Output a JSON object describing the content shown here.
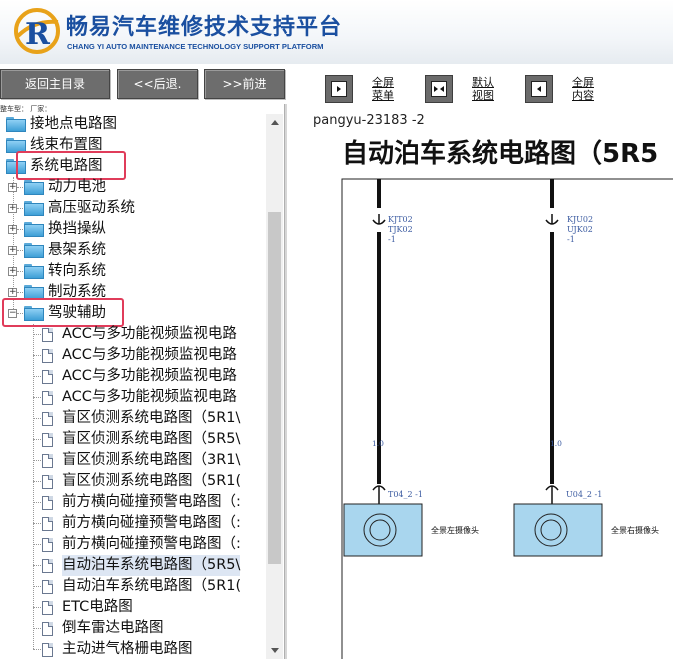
{
  "header": {
    "title": "畅易汽车维修技术支持平台",
    "subtitle": "CHANG YI AUTO MAINTENANCE TECHNOLOGY SUPPORT PLATFORM",
    "brand_color": "#1a4fa0"
  },
  "toolbar": {
    "home_label": "返回主目录",
    "back_label": "<<后退.",
    "forward_label": ">>前进",
    "tools": [
      {
        "icon": "fullscreen-menu-icon",
        "label": "全屏\n菜单"
      },
      {
        "icon": "default-view-icon",
        "label": "默认\n视图"
      },
      {
        "icon": "fullscreen-content-icon",
        "label": "全屏\n内容"
      }
    ]
  },
  "sidebar": {
    "meta": "整车型：  厂家：",
    "tree": [
      {
        "label": "接地点电路图",
        "type": "folder",
        "level": 0
      },
      {
        "label": "线束布置图",
        "type": "folder",
        "level": 0
      },
      {
        "label": "系统电路图",
        "type": "folder-open",
        "level": 0,
        "highlighted": true
      },
      {
        "label": "动力电池",
        "type": "folder",
        "level": 1
      },
      {
        "label": "高压驱动系统",
        "type": "folder",
        "level": 1
      },
      {
        "label": "换挡操纵",
        "type": "folder",
        "level": 1
      },
      {
        "label": "悬架系统",
        "type": "folder",
        "level": 1
      },
      {
        "label": "转向系统",
        "type": "folder",
        "level": 1
      },
      {
        "label": "制动系统",
        "type": "folder",
        "level": 1
      },
      {
        "label": "驾驶辅助",
        "type": "folder-open",
        "level": 1,
        "highlighted": true
      },
      {
        "label": "ACC与多功能视频监视电路",
        "type": "doc",
        "level": 2
      },
      {
        "label": "ACC与多功能视频监视电路",
        "type": "doc",
        "level": 2
      },
      {
        "label": "ACC与多功能视频监视电路",
        "type": "doc",
        "level": 2
      },
      {
        "label": "ACC与多功能视频监视电路",
        "type": "doc",
        "level": 2
      },
      {
        "label": "盲区侦测系统电路图（5R1\\",
        "type": "doc",
        "level": 2
      },
      {
        "label": "盲区侦测系统电路图（5R5\\",
        "type": "doc",
        "level": 2
      },
      {
        "label": "盲区侦测系统电路图（3R1\\",
        "type": "doc",
        "level": 2
      },
      {
        "label": "盲区侦测系统电路图（5R1(",
        "type": "doc",
        "level": 2
      },
      {
        "label": "前方横向碰撞预警电路图（:",
        "type": "doc",
        "level": 2
      },
      {
        "label": "前方横向碰撞预警电路图（:",
        "type": "doc",
        "level": 2
      },
      {
        "label": "前方横向碰撞预警电路图（:",
        "type": "doc",
        "level": 2
      },
      {
        "label": "自动泊车系统电路图（5R5\\",
        "type": "doc",
        "level": 2,
        "selected": true
      },
      {
        "label": "自动泊车系统电路图（5R1(",
        "type": "doc",
        "level": 2
      },
      {
        "label": "ETC电路图",
        "type": "doc",
        "level": 2
      },
      {
        "label": "倒车雷达电路图",
        "type": "doc",
        "level": 2
      },
      {
        "label": "主动进气格栅电路图",
        "type": "doc",
        "level": 2
      }
    ]
  },
  "content": {
    "doc_code": "pangyu-23183 -2",
    "title": "自动泊车系统电路图（5R5",
    "diagram": {
      "left": {
        "connector_top": [
          "KJT02",
          "TJK02",
          "-1"
        ],
        "wire_size": "1.0",
        "connector_bottom": "T04_2  -1",
        "device_label": "全景左摄像头"
      },
      "right": {
        "connector_top": [
          "KJU02",
          "UJK02",
          "-1"
        ],
        "wire_size": "1.0",
        "connector_bottom": "U04_2  -1",
        "device_label": "全景右摄像头"
      }
    }
  }
}
